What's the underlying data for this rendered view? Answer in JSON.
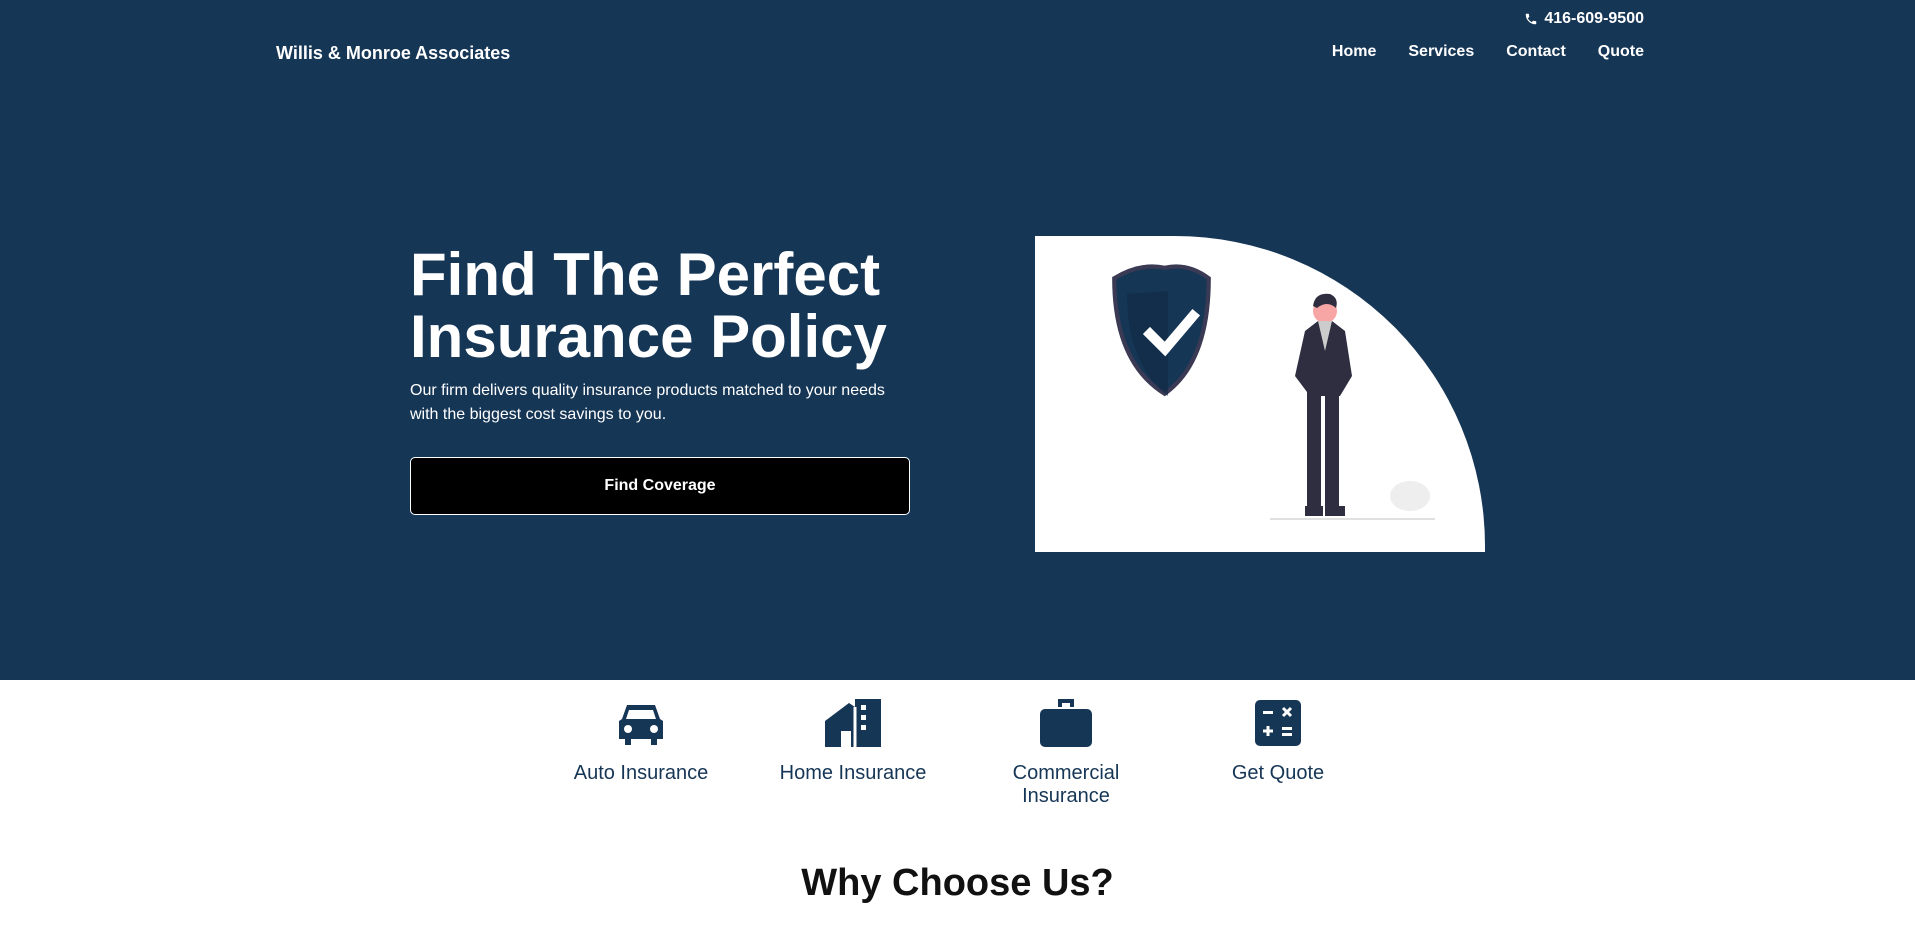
{
  "header": {
    "phone_icon": "phone-icon",
    "phone": "416-609-9500",
    "brand": "Willis & Monroe Associates",
    "nav": [
      "Home",
      "Services",
      "Contact",
      "Quote"
    ]
  },
  "hero": {
    "title_line1": "Find The Perfect",
    "title_line2": "Insurance Policy",
    "subtitle": "Our firm delivers quality insurance products matched to your needs with the biggest cost savings to you.",
    "cta": "Find Coverage"
  },
  "services": [
    {
      "label": "Auto Insurance",
      "icon": "car-icon"
    },
    {
      "label": "Home Insurance",
      "icon": "house-icon"
    },
    {
      "label": "Commercial Insurance",
      "icon": "briefcase-icon"
    },
    {
      "label": "Get Quote",
      "icon": "calculator-icon"
    }
  ],
  "why_heading": "Why Choose Us?",
  "colors": {
    "primary": "#163656",
    "button": "#000000",
    "text_light": "#ffffff"
  }
}
